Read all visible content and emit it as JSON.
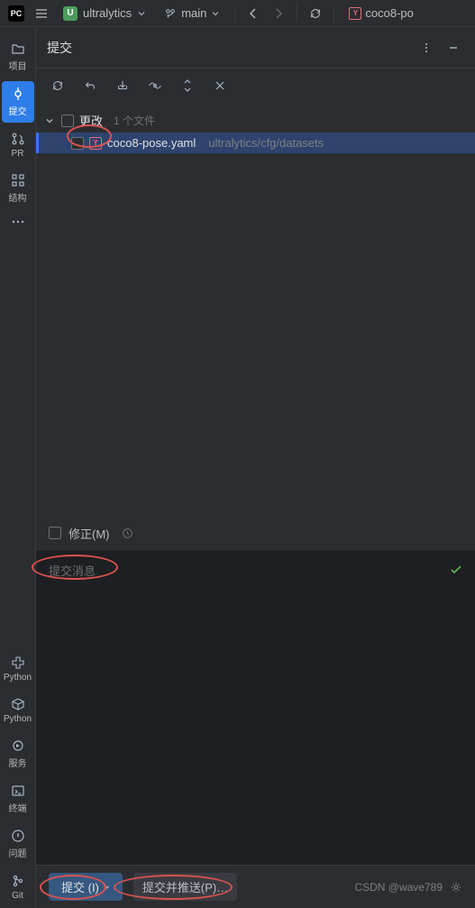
{
  "topbar": {
    "app_icon": "PC",
    "project_icon": "U",
    "project_name": "ultralytics",
    "branch_name": "main",
    "open_file": "coco8-po"
  },
  "sidebar": {
    "items": [
      {
        "label": "项目"
      },
      {
        "label": "提交"
      },
      {
        "label": "PR"
      },
      {
        "label": "结构"
      },
      {
        "label": "Python"
      },
      {
        "label": "Python"
      },
      {
        "label": "服务"
      },
      {
        "label": "终端"
      },
      {
        "label": "问题"
      },
      {
        "label": "Git"
      }
    ]
  },
  "commit_panel": {
    "title": "提交",
    "change_group": "更改",
    "file_count": "1 个文件",
    "file_name": "coco8-pose.yaml",
    "file_path": "ultralytics/cfg/datasets",
    "amend_label": "修正(M)",
    "message_placeholder": "提交消息",
    "commit_button": "提交 (I)",
    "commit_push_button": "提交并推送(P)…",
    "watermark": "CSDN @wave789"
  }
}
